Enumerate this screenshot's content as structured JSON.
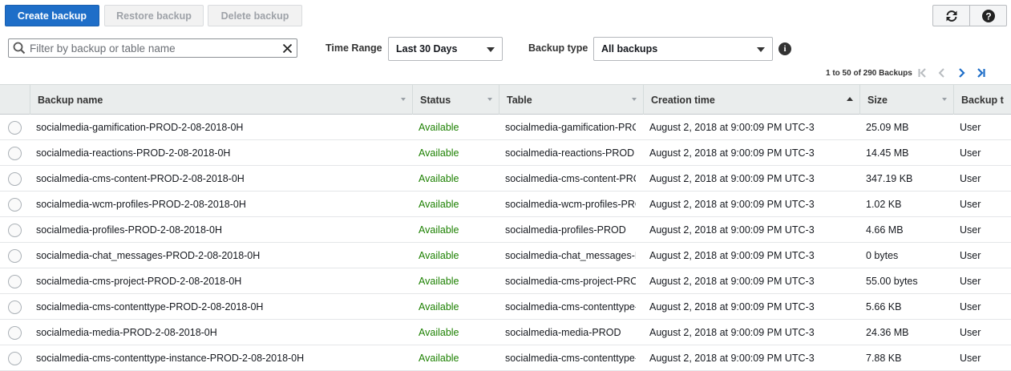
{
  "toolbar": {
    "create_label": "Create backup",
    "restore_label": "Restore backup",
    "delete_label": "Delete backup",
    "colors": {
      "primary": "#1e6ec8",
      "disabled_text": "#9ea2a8"
    }
  },
  "filter": {
    "search_placeholder": "Filter by backup or table name",
    "time_range_label": "Time Range",
    "time_range_value": "Last 30 Days",
    "backup_type_label": "Backup type",
    "backup_type_value": "All backups",
    "info_icon": "info-icon"
  },
  "pagination": {
    "text": "1 to 50 of 290 Backups"
  },
  "table": {
    "columns": [
      "Backup name",
      "Status",
      "Table",
      "Creation time",
      "Size",
      "Backup t"
    ],
    "rows": [
      {
        "name": "socialmedia-gamification-PROD-2-08-2018-0H",
        "status": "Available",
        "table": "socialmedia-gamification-PROD",
        "created": "August 2, 2018 at 9:00:09 PM UTC-3",
        "size": "25.09 MB",
        "type": "User"
      },
      {
        "name": "socialmedia-reactions-PROD-2-08-2018-0H",
        "status": "Available",
        "table": "socialmedia-reactions-PROD",
        "created": "August 2, 2018 at 9:00:09 PM UTC-3",
        "size": "14.45 MB",
        "type": "User"
      },
      {
        "name": "socialmedia-cms-content-PROD-2-08-2018-0H",
        "status": "Available",
        "table": "socialmedia-cms-content-PROD",
        "created": "August 2, 2018 at 9:00:09 PM UTC-3",
        "size": "347.19 KB",
        "type": "User"
      },
      {
        "name": "socialmedia-wcm-profiles-PROD-2-08-2018-0H",
        "status": "Available",
        "table": "socialmedia-wcm-profiles-PROD",
        "created": "August 2, 2018 at 9:00:09 PM UTC-3",
        "size": "1.02 KB",
        "type": "User"
      },
      {
        "name": "socialmedia-profiles-PROD-2-08-2018-0H",
        "status": "Available",
        "table": "socialmedia-profiles-PROD",
        "created": "August 2, 2018 at 9:00:09 PM UTC-3",
        "size": "4.66 MB",
        "type": "User"
      },
      {
        "name": "socialmedia-chat_messages-PROD-2-08-2018-0H",
        "status": "Available",
        "table": "socialmedia-chat_messages-PROD",
        "created": "August 2, 2018 at 9:00:09 PM UTC-3",
        "size": "0 bytes",
        "type": "User"
      },
      {
        "name": "socialmedia-cms-project-PROD-2-08-2018-0H",
        "status": "Available",
        "table": "socialmedia-cms-project-PROD",
        "created": "August 2, 2018 at 9:00:09 PM UTC-3",
        "size": "55.00 bytes",
        "type": "User"
      },
      {
        "name": "socialmedia-cms-contenttype-PROD-2-08-2018-0H",
        "status": "Available",
        "table": "socialmedia-cms-contenttype-PROD",
        "created": "August 2, 2018 at 9:00:09 PM UTC-3",
        "size": "5.66 KB",
        "type": "User"
      },
      {
        "name": "socialmedia-media-PROD-2-08-2018-0H",
        "status": "Available",
        "table": "socialmedia-media-PROD",
        "created": "August 2, 2018 at 9:00:09 PM UTC-3",
        "size": "24.36 MB",
        "type": "User"
      },
      {
        "name": "socialmedia-cms-contenttype-instance-PROD-2-08-2018-0H",
        "status": "Available",
        "table": "socialmedia-cms-contenttype-instance-PROD",
        "created": "August 2, 2018 at 9:00:09 PM UTC-3",
        "size": "7.88 KB",
        "type": "User"
      }
    ]
  }
}
